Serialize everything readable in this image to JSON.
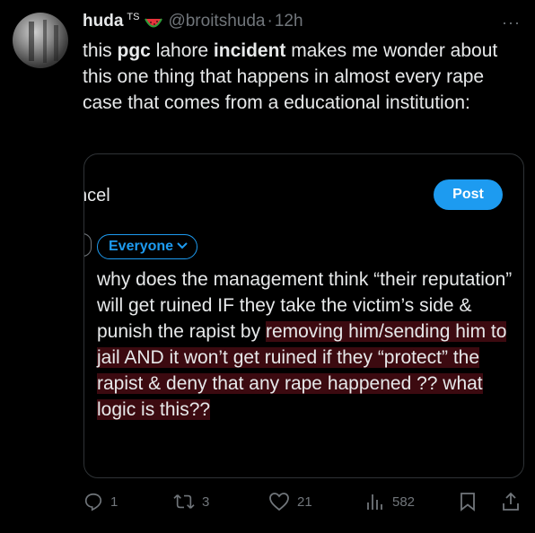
{
  "author": {
    "name": "huda",
    "badge_text": "TS",
    "handle": "@broitshuda",
    "separator": "·",
    "time": "12h"
  },
  "tweet": {
    "line1_a": "this ",
    "line1_b": "pgc",
    "line1_c": " lahore ",
    "line1_d": "incident",
    "line1_e": " makes me wonder",
    "rest": "about this one thing that happens in almost every rape case that comes from a educational institution:"
  },
  "screenshot": {
    "cancel_label": "ncel",
    "post_label": "Post",
    "audience_label": "Everyone",
    "text_plain": "why does the management think “their reputation” will get ruined IF they take the victim’s side & punish the rapist by ",
    "text_hl1": "removing him/sending ",
    "text_hl2": "him to jail AND it won’t get ruined if they “protect” the rapist & deny that any rape happened ?? what logic is this??"
  },
  "actions": {
    "replies": "1",
    "retweets": "3",
    "likes": "21",
    "views": "582"
  },
  "icons": [
    "avatar",
    "watermelon-icon",
    "more-dots-icon",
    "reply-icon",
    "retweet-icon",
    "like-icon",
    "views-icon",
    "bookmark-icon",
    "share-icon"
  ],
  "colors": {
    "accent": "#1d9bf0",
    "muted": "#71767b",
    "highlight": "#3c0a10",
    "background": "#000000"
  }
}
